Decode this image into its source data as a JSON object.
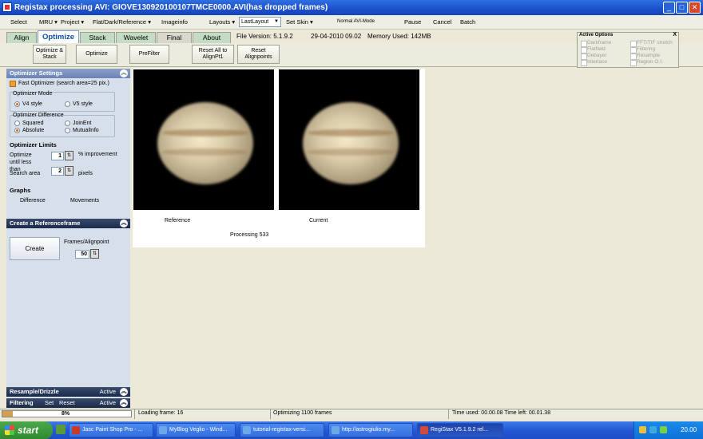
{
  "window": {
    "title": "Registax processing AVI: GIOVE130920100107TMCE0000.AVI(has dropped frames)",
    "min": "_",
    "max": "□",
    "close": "✕"
  },
  "menu": {
    "select": "Select",
    "mru": "MRU ▾",
    "project": "Project ▾",
    "flat": "Flat/Dark/Reference ▾",
    "imageinfo": "Imageinfo",
    "layouts": "Layouts ▾",
    "layout_value": "LastLayout",
    "setskin": "Set Skin ▾",
    "normal_avi": "Normal AVI-Mode",
    "pause": "Pause",
    "cancel": "Cancel",
    "batch": "Batch"
  },
  "tabs": [
    "Align",
    "Optimize",
    "Stack",
    "Wavelet",
    "Final",
    "About"
  ],
  "fileinfo": {
    "version": "File Version: 5.1.9.2",
    "date": "29-04-2010 09.02",
    "memory": "Memory Used: 142MB"
  },
  "toolbar": {
    "opt_stack": "Optimize & Stack",
    "optimize": "Optimize",
    "prefilter": "PreFilter",
    "reset_all": "Reset All to AlignPt1",
    "reset_align": "Reset Alignpoints"
  },
  "active_options": {
    "title": "Active Options",
    "close": "X",
    "items": [
      "Darkframe",
      "FFT/TIF stretch",
      "Flatfield",
      "Filtering",
      "Debayer",
      "Resample",
      "Interlace",
      "Region O.I."
    ]
  },
  "sidebar": {
    "opt_settings": "Optimizer Settings",
    "fast_opt": "Fast Optimizer (search area=25 pix.)",
    "mode_label": "Optimizer Mode",
    "v4": "V4 style",
    "v5": "V5 style",
    "diff_label": "Optimizer Difference",
    "squared": "Squared",
    "joinent": "JoinEnt",
    "absolute": "Absolute",
    "mutualinfo": "MutualInfo",
    "limits": "Optimizer Limits",
    "opt_until": "Optimize until less than",
    "opt_until_val": "1",
    "improvement": "% improvement",
    "search_area": "Search area",
    "search_val": "2",
    "pixels": "pixels",
    "graphs": "Graphs",
    "difference": "Difference",
    "movements": "Movements",
    "create_ref": "Create a Referenceframe",
    "create": "Create",
    "frames_align": "Frames/Alignpoint",
    "frames_val": "50",
    "resample": "Resample/Drizzle",
    "resample_active": "Active",
    "filtering": "Filtering",
    "set": "Set",
    "reset": "Reset",
    "filtering_active": "Active"
  },
  "canvas": {
    "reference": "Reference",
    "current": "Current",
    "processing": "Processing 533"
  },
  "status": {
    "progress_pct": "8%",
    "progress_value": 0.08,
    "loading": "Loading frame: 16",
    "optimizing": "Optimizing 1100 frames",
    "time": "Time used: 00.00.08 Time left: 00.01.38"
  },
  "taskbar": {
    "start": "start",
    "tasks": [
      "Jasc Paint Shop Pro - ...",
      "MyBlog Veglio - Wind...",
      "tutorial-registax-versi...",
      "http://astrogiulio.my...",
      "RegiStax V5.1.9.2 rel..."
    ],
    "clock": "20.00"
  }
}
